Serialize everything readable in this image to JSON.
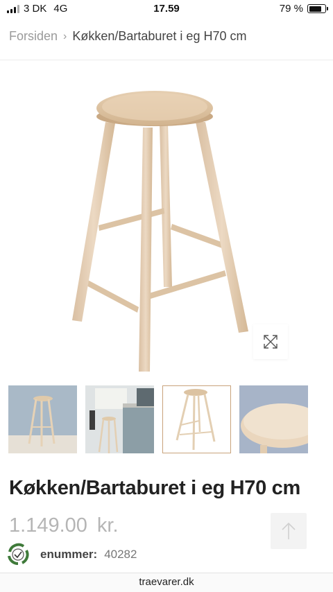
{
  "status_bar": {
    "carrier": "3 DK",
    "network": "4G",
    "time": "17.59",
    "battery": "79 %",
    "battery_level": 0.79
  },
  "breadcrumb": {
    "home": "Forsiden",
    "separator": "›",
    "current": "Køkken/Bartaburet i eg H70 cm"
  },
  "gallery": {
    "main_image_alt": "barstool",
    "zoom_icon": "expand-icon",
    "thumbnails": [
      {
        "name": "thumbnail-stool-blue-wall"
      },
      {
        "name": "thumbnail-stool-kitchen"
      },
      {
        "name": "thumbnail-stool-white",
        "active": true
      },
      {
        "name": "thumbnail-seat-closeup"
      }
    ]
  },
  "product": {
    "title": "Køkken/Bartaburet i eg H70 cm",
    "price": "1.149.00",
    "currency": "kr.",
    "sku_label": "enummer:",
    "sku_value": "40282"
  },
  "browser": {
    "url": "traevarer.dk"
  },
  "colors": {
    "accent_border": "#c8a27a",
    "wood": "#e3cbb0",
    "price_gray": "#b5b5b5"
  }
}
